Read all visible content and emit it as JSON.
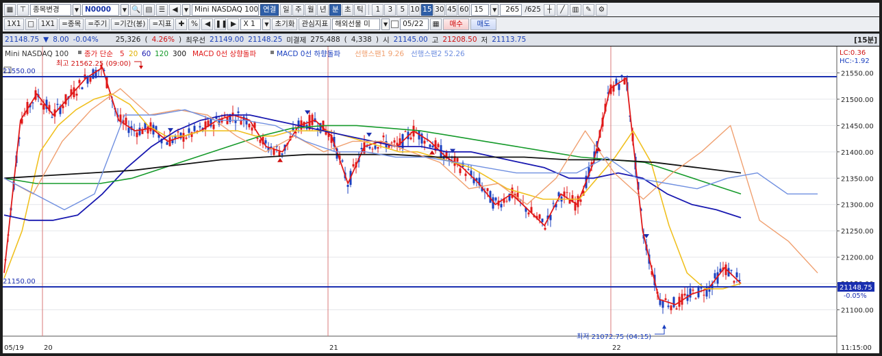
{
  "toolbar1": {
    "code": "N0000",
    "change_item_label": "종목변경",
    "instrument": "Mini NASDAQ 100",
    "link_label": "연결",
    "periods": [
      "일",
      "주",
      "월",
      "년",
      "분",
      "초",
      "틱"
    ],
    "active_period": "분",
    "intervals": [
      "1",
      "3",
      "5",
      "10",
      "15",
      "30",
      "45",
      "60"
    ],
    "active_interval": "15",
    "interval_value": "15",
    "bar_count": "265",
    "bar_total": "/625"
  },
  "toolbar2": {
    "layout1": "1X1",
    "layout2": "1X1",
    "item_btn": "=종목",
    "period_btn": "=주기",
    "range_btn": "=기간(봉)",
    "indicator_btn": "=지표",
    "percent_btn": "%",
    "zoom_value": "X 1",
    "reset_btn": "초기화",
    "interest_btn": "관심지표",
    "futures_select": "해외선물 미",
    "date_value": "05/22",
    "buy_btn": "매수",
    "sell_btn": "매도"
  },
  "quote": {
    "price": "21148.75",
    "arrow": "▼",
    "change": "8.00",
    "change_pct": "-0.04%",
    "volume": "25,326",
    "volume_pct": "4.26%",
    "ask_label": "최우선",
    "bid": "21149.00",
    "ask": "21148.25",
    "oi_label": "미결제",
    "open_interest": "275,488",
    "oi_change": "4,338",
    "open_label": "시",
    "open": "21145.00",
    "high_label": "고",
    "high": "21208.50",
    "low_label": "저",
    "low": "21113.75",
    "timeframe": "[15분]"
  },
  "legend": {
    "instrument": "Mini NASDAQ 100",
    "ma_label": "종가 단순",
    "ma5": "5",
    "ma20": "20",
    "ma60": "60",
    "ma120": "120",
    "ma300": "300",
    "macd_up": "MACD 0선 상향돌파",
    "macd_down": "MACD 0선 하향돌파",
    "span1": "선행스팬1 9.26",
    "span2": "선행스팬2 52.26"
  },
  "annotations": {
    "high_marker": "최고 21562.25 (09:00)",
    "low_marker": "최저 21072.75 (04:15)",
    "upper_line": "21550.00",
    "lower_line": "21150.00",
    "lc": "LC:0.36",
    "hc": "HC:-1.92",
    "last_price": "21148.75",
    "last_pct": "-0.05%"
  },
  "axis": {
    "y_ticks": [
      "21550.00",
      "21500.00",
      "21450.00",
      "21400.00",
      "21350.00",
      "21300.00",
      "21250.00",
      "21200.00",
      "21150.00",
      "21100.00"
    ],
    "x_labels": [
      "05/19",
      "20",
      "21",
      "22"
    ],
    "time_label": "11:15:00"
  },
  "colors": {
    "candle_up": "#e01818",
    "candle_down": "#1a3fbf",
    "ma5": "#e01818",
    "ma20": "#f0c020",
    "ma60": "#1818b0",
    "ma120": "#159a2a",
    "ma300": "#111111",
    "span1": "#f0a070",
    "span2": "#6f8fe0"
  },
  "chart_data": {
    "type": "line",
    "ylim": [
      21050,
      21600
    ],
    "series": [
      {
        "name": "5",
        "values": [
          21170,
          21460,
          21510,
          21470,
          21505,
          21540,
          21560,
          21460,
          21440,
          21445,
          21420,
          21430,
          21440,
          21460,
          21470,
          21460,
          21410,
          21400,
          21450,
          21460,
          21430,
          21340,
          21410,
          21420,
          21410,
          21440,
          21420,
          21390,
          21370,
          21340,
          21300,
          21320,
          21290,
          21260,
          21320,
          21300,
          21380,
          21520,
          21540,
          21250,
          21120,
          21110,
          21130,
          21140,
          21180,
          21150
        ]
      },
      {
        "name": "20",
        "values": [
          21160,
          21250,
          21400,
          21450,
          21480,
          21500,
          21510,
          21490,
          21450,
          21430,
          21430,
          21440,
          21440,
          21440,
          21430,
          21430,
          21440,
          21440,
          21440,
          21430,
          21420,
          21410,
          21400,
          21400,
          21390,
          21380,
          21370,
          21350,
          21330,
          21320,
          21310,
          21310,
          21310,
          21350,
          21390,
          21440,
          21380,
          21260,
          21170,
          21140,
          21140,
          21150
        ]
      },
      {
        "name": "60",
        "values": [
          21280,
          21270,
          21270,
          21280,
          21320,
          21370,
          21410,
          21440,
          21460,
          21470,
          21470,
          21460,
          21450,
          21440,
          21430,
          21420,
          21410,
          21410,
          21400,
          21400,
          21390,
          21380,
          21370,
          21350,
          21350,
          21360,
          21350,
          21320,
          21300,
          21290,
          21275
        ]
      },
      {
        "name": "120",
        "values": [
          21350,
          21340,
          21340,
          21340,
          21350,
          21370,
          21390,
          21410,
          21430,
          21445,
          21450,
          21450,
          21445,
          21440,
          21430,
          21420,
          21410,
          21400,
          21390,
          21385,
          21380,
          21360,
          21340,
          21320
        ]
      },
      {
        "name": "300",
        "values": [
          21350,
          21355,
          21360,
          21365,
          21375,
          21385,
          21390,
          21395,
          21395,
          21395,
          21390,
          21390,
          21390,
          21385,
          21385,
          21380,
          21370,
          21360
        ]
      },
      {
        "name": "선행스팬1 9.26",
        "values": [
          21350,
          21320,
          21420,
          21480,
          21520,
          21470,
          21480,
          21470,
          21430,
          21400,
          21430,
          21400,
          21420,
          21420,
          21400,
          21380,
          21330,
          21340,
          21300,
          21350,
          21440,
          21360,
          21310,
          21360,
          21400,
          21450,
          21270,
          21230,
          21170
        ]
      },
      {
        "name": "선행스팬2 52.26",
        "values": [
          21350,
          21320,
          21290,
          21320,
          21470,
          21470,
          21480,
          21460,
          21460,
          21450,
          21420,
          21400,
          21400,
          21390,
          21390,
          21380,
          21370,
          21360,
          21360,
          21360,
          21390,
          21350,
          21340,
          21330,
          21350,
          21360,
          21320,
          21320
        ]
      }
    ]
  }
}
